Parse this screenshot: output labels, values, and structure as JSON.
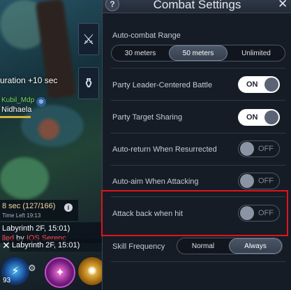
{
  "game": {
    "buff_duration": "uration +10 sec",
    "ally_name": "Kubil_Mdp",
    "target_name": "Nidhaela",
    "quest_title": "8 sec (127/166)",
    "quest_sub": "Time Left 19:13",
    "chat_line1": "Labyrinth 2F, 15:01)",
    "chat_line2_a": "lled",
    "chat_line2_b": " by ",
    "chat_line2_c": "IOS Serenc",
    "chat_line3": "Labyrinth 2F, 15:01)",
    "level": "93"
  },
  "panel": {
    "title": "Combat Settings",
    "help": "?",
    "close": "✕",
    "auto_combat_range": {
      "label": "Auto-combat Range",
      "options": [
        "30 meters",
        "50 meters",
        "Unlimited"
      ],
      "selected": "50 meters"
    },
    "party_leader": {
      "label": "Party Leader-Centered Battle",
      "state": "ON"
    },
    "party_target": {
      "label": "Party Target Sharing",
      "state": "ON"
    },
    "auto_return": {
      "label": "Auto-return When Resurrected",
      "state": "OFF"
    },
    "auto_aim": {
      "label": "Auto-aim When Attacking",
      "state": "OFF"
    },
    "attack_back": {
      "label": "Attack back when hit",
      "state": "OFF"
    },
    "skill_frequency": {
      "label": "Skill Frequency",
      "options": [
        "Normal",
        "Always"
      ],
      "selected": "Always"
    }
  },
  "colors": {
    "highlight": "#e0141a",
    "toggle_on_bg": "#ffffff",
    "toggle_off_bg": "#141a22",
    "panel_bg": "#161c26"
  }
}
